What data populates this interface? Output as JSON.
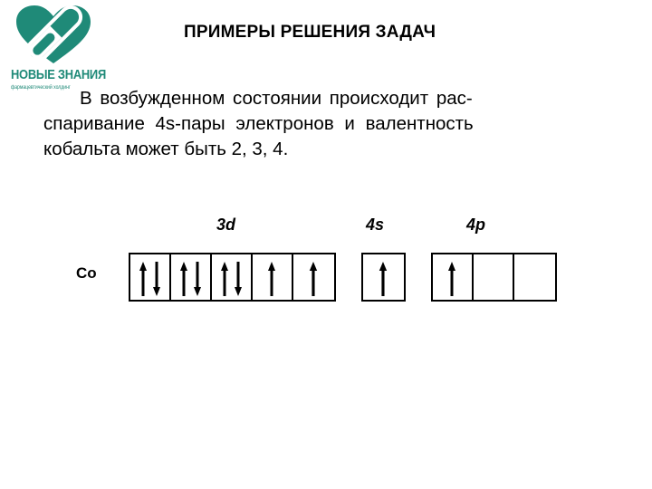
{
  "logo": {
    "brand": "НОВЫЕ ЗНАНИЯ",
    "tagline": "фармацевтический холдинг",
    "color": "#1f8a78"
  },
  "title": "ПРИМЕРЫ РЕШЕНИЯ ЗАДАЧ",
  "paragraph": {
    "lines": [
      "В возбужденном состоянии происходит рас-",
      "спаривание 4s-пары электронов и валентность",
      "кобальта может быть 2, 3, 4."
    ]
  },
  "diagram": {
    "element": "Co",
    "sublevels": [
      {
        "label": "3d",
        "cells": [
          [
            "up",
            "down"
          ],
          [
            "up",
            "down"
          ],
          [
            "up",
            "down"
          ],
          [
            "up"
          ],
          [
            "up"
          ]
        ]
      },
      {
        "label": "4s",
        "cells": [
          [
            "up"
          ]
        ]
      },
      {
        "label": "4p",
        "cells": [
          [
            "up"
          ],
          [],
          []
        ]
      }
    ]
  }
}
